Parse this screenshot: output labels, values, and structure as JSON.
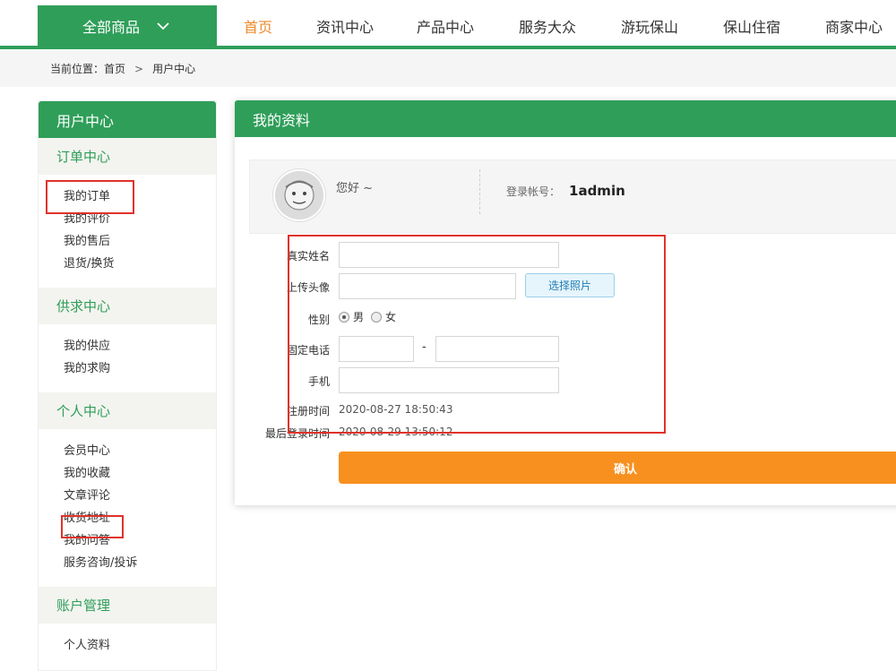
{
  "header": {
    "all_goods_label": "全部商品",
    "nav": [
      "首页",
      "资讯中心",
      "产品中心",
      "服务大众",
      "游玩保山",
      "保山住宿",
      "商家中心"
    ],
    "active_nav": "首页"
  },
  "breadcrumb": {
    "prefix": "当前位置：",
    "home": "首页",
    "separator": ">",
    "current": "用户中心"
  },
  "sidebar": {
    "title": "用户中心",
    "groups": [
      {
        "title": "订单中心",
        "items": [
          "我的订单",
          "我的评价",
          "我的售后",
          "退货/换货"
        ]
      },
      {
        "title": "供求中心",
        "items": [
          "我的供应",
          "我的求购"
        ]
      },
      {
        "title": "个人中心",
        "items": [
          "会员中心",
          "我的收藏",
          "文章评论",
          "收货地址",
          "我的问答",
          "服务咨询/投诉"
        ]
      },
      {
        "title": "账户管理",
        "items": [
          "个人资料"
        ]
      }
    ]
  },
  "panel": {
    "title": "我的资料",
    "greeting": "您好 ~",
    "account_label": "登录帐号：",
    "account_value": "1admin",
    "form": {
      "real_name_label": "真实姓名",
      "upload_avatar_label": "上传头像",
      "choose_photo_button": "选择照片",
      "gender_label": "性别",
      "gender_male": "男",
      "gender_female": "女",
      "gender_selected": "男",
      "phone_label": "固定电话",
      "phone_separator": "-",
      "mobile_label": "手机",
      "register_time_label": "注册时间",
      "register_time_value": "2020-08-27 18:50:43",
      "last_login_label": "最后登录时间",
      "last_login_value": "2020-08-29 13:50:12",
      "confirm_button": "确认"
    }
  },
  "colors": {
    "brand_green": "#2e9e59",
    "active_orange": "#ef8a2c",
    "confirm_orange": "#f7901e",
    "highlight_red": "#e0312b"
  }
}
